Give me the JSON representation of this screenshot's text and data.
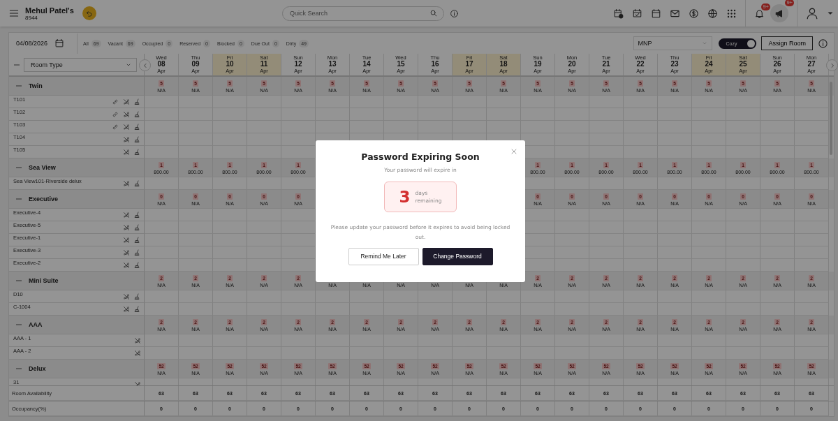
{
  "header": {
    "property": "Mehul Patel's",
    "code": "8944",
    "search": {
      "placeholder": "Quick Search"
    },
    "notifications": {
      "badge": "9+"
    },
    "announcements": {
      "badge": "9+"
    }
  },
  "filters": {
    "date": "04/08/2026",
    "statuses": [
      {
        "label": "All",
        "count": "69"
      },
      {
        "label": "Vacant",
        "count": "69"
      },
      {
        "label": "Occupied",
        "count": "0"
      },
      {
        "label": "Reserved",
        "count": "0"
      },
      {
        "label": "Blocked",
        "count": "0"
      },
      {
        "label": "Due Out",
        "count": "0"
      },
      {
        "label": "Dirty",
        "count": "49"
      }
    ],
    "rate_plan": "MNP",
    "view_toggle": {
      "label": "Cozy",
      "on": true
    },
    "assign_button": "Assign Room"
  },
  "grid": {
    "room_type_select": "Room Type",
    "days": [
      {
        "weekday": "Wed",
        "date": "08",
        "month": "Apr",
        "weekend": false
      },
      {
        "weekday": "Thu",
        "date": "09",
        "month": "Apr",
        "weekend": false
      },
      {
        "weekday": "Fri",
        "date": "10",
        "month": "Apr",
        "weekend": true
      },
      {
        "weekday": "Sat",
        "date": "11",
        "month": "Apr",
        "weekend": true
      },
      {
        "weekday": "Sun",
        "date": "12",
        "month": "Apr",
        "weekend": false
      },
      {
        "weekday": "Mon",
        "date": "13",
        "month": "Apr",
        "weekend": false
      },
      {
        "weekday": "Tue",
        "date": "14",
        "month": "Apr",
        "weekend": false
      },
      {
        "weekday": "Wed",
        "date": "15",
        "month": "Apr",
        "weekend": false
      },
      {
        "weekday": "Thu",
        "date": "16",
        "month": "Apr",
        "weekend": false
      },
      {
        "weekday": "Fri",
        "date": "17",
        "month": "Apr",
        "weekend": true
      },
      {
        "weekday": "Sat",
        "date": "18",
        "month": "Apr",
        "weekend": true
      },
      {
        "weekday": "Sun",
        "date": "19",
        "month": "Apr",
        "weekend": false
      },
      {
        "weekday": "Mon",
        "date": "20",
        "month": "Apr",
        "weekend": false
      },
      {
        "weekday": "Tue",
        "date": "21",
        "month": "Apr",
        "weekend": false
      },
      {
        "weekday": "Wed",
        "date": "22",
        "month": "Apr",
        "weekend": false
      },
      {
        "weekday": "Thu",
        "date": "23",
        "month": "Apr",
        "weekend": false
      },
      {
        "weekday": "Fri",
        "date": "24",
        "month": "Apr",
        "weekend": true
      },
      {
        "weekday": "Sat",
        "date": "25",
        "month": "Apr",
        "weekend": true
      },
      {
        "weekday": "Sun",
        "date": "26",
        "month": "Apr",
        "weekend": false
      },
      {
        "weekday": "Mon",
        "date": "27",
        "month": "Apr",
        "weekend": false
      }
    ],
    "groups": [
      {
        "name": "Twin",
        "expanded": true,
        "cells": [
          {
            "count": "5",
            "rate": "N/A"
          },
          {
            "count": "5",
            "rate": "N/A"
          },
          {
            "count": "5",
            "rate": "N/A"
          },
          {
            "count": "5",
            "rate": "N/A"
          },
          {
            "count": "5",
            "rate": "N/A"
          },
          {
            "count": "5",
            "rate": "N/A"
          },
          {
            "count": "5",
            "rate": "N/A"
          },
          {
            "count": "5",
            "rate": "N/A"
          },
          {
            "count": "5",
            "rate": "N/A"
          },
          {
            "count": "5",
            "rate": "N/A"
          },
          {
            "count": "5",
            "rate": "N/A"
          },
          {
            "count": "5",
            "rate": "N/A"
          },
          {
            "count": "5",
            "rate": "N/A"
          },
          {
            "count": "5",
            "rate": "N/A"
          },
          {
            "count": "5",
            "rate": "N/A"
          },
          {
            "count": "5",
            "rate": "N/A"
          },
          {
            "count": "5",
            "rate": "N/A"
          },
          {
            "count": "5",
            "rate": "N/A"
          },
          {
            "count": "5",
            "rate": "N/A"
          },
          {
            "count": "5",
            "rate": "N/A"
          }
        ],
        "rooms": [
          {
            "name": "T101",
            "linked": true,
            "non_smoking": true,
            "housekeeping": true
          },
          {
            "name": "T102",
            "linked": true,
            "non_smoking": true,
            "housekeeping": true
          },
          {
            "name": "T103",
            "linked": true,
            "non_smoking": true,
            "housekeeping": true
          },
          {
            "name": "T104",
            "linked": false,
            "non_smoking": true,
            "housekeeping": true
          },
          {
            "name": "T105",
            "linked": false,
            "non_smoking": true,
            "housekeeping": true
          }
        ]
      },
      {
        "name": "Sea View",
        "expanded": true,
        "cells": [
          {
            "count": "1",
            "rate": "800.00"
          },
          {
            "count": "1",
            "rate": "800.00"
          },
          {
            "count": "1",
            "rate": "800.00"
          },
          {
            "count": "1",
            "rate": "800.00"
          },
          {
            "count": "1",
            "rate": "800.00"
          },
          {},
          {},
          {},
          {},
          {},
          {},
          {
            "count": "1",
            "rate": "800.00"
          },
          {
            "count": "1",
            "rate": "800.00"
          },
          {
            "count": "1",
            "rate": "800.00"
          },
          {
            "count": "1",
            "rate": "800.00"
          },
          {
            "count": "1",
            "rate": "800.00"
          },
          {
            "count": "1",
            "rate": "800.00"
          },
          {
            "count": "1",
            "rate": "800.00"
          },
          {
            "count": "1",
            "rate": "800.00"
          },
          {
            "count": "1",
            "rate": "800.00"
          }
        ],
        "rooms": [
          {
            "name": "Sea View101-Riverside delux",
            "linked": false,
            "non_smoking": true,
            "housekeeping": true
          }
        ]
      },
      {
        "name": "Executive",
        "expanded": true,
        "cells": [
          {
            "count": "0",
            "rate": "N/A"
          },
          {
            "count": "0",
            "rate": "N/A"
          },
          {
            "count": "0",
            "rate": "N/A"
          },
          {
            "count": "0",
            "rate": "N/A"
          },
          {
            "count": "0",
            "rate": "N/A"
          },
          {},
          {},
          {},
          {},
          {},
          {},
          {
            "count": "0",
            "rate": "N/A"
          },
          {
            "count": "0",
            "rate": "N/A"
          },
          {
            "count": "0",
            "rate": "N/A"
          },
          {
            "count": "0",
            "rate": "N/A"
          },
          {
            "count": "0",
            "rate": "N/A"
          },
          {
            "count": "0",
            "rate": "N/A"
          },
          {
            "count": "0",
            "rate": "N/A"
          },
          {
            "count": "0",
            "rate": "N/A"
          },
          {
            "count": "0",
            "rate": "N/A"
          }
        ],
        "rooms": [
          {
            "name": "Executive-4",
            "linked": false,
            "non_smoking": true,
            "housekeeping": true
          },
          {
            "name": "Executive-5",
            "linked": false,
            "non_smoking": true,
            "housekeeping": true
          },
          {
            "name": "Executive-1",
            "linked": false,
            "non_smoking": true,
            "housekeeping": true
          },
          {
            "name": "Executive-3",
            "linked": false,
            "non_smoking": true,
            "housekeeping": true
          },
          {
            "name": "Executive-2",
            "linked": false,
            "non_smoking": true,
            "housekeeping": true
          }
        ]
      },
      {
        "name": "Mini Suite",
        "expanded": true,
        "cells": [
          {
            "count": "2",
            "rate": "N/A"
          },
          {
            "count": "2",
            "rate": "N/A"
          },
          {
            "count": "2",
            "rate": "N/A"
          },
          {
            "count": "2",
            "rate": "N/A"
          },
          {
            "count": "2",
            "rate": "N/A"
          },
          {
            "rate": "N/A"
          },
          {
            "rate": "N/A"
          },
          {
            "rate": "N/A"
          },
          {
            "rate": "N/A"
          },
          {
            "rate": "N/A"
          },
          {
            "rate": "N/A"
          },
          {
            "count": "2",
            "rate": "N/A"
          },
          {
            "count": "2",
            "rate": "N/A"
          },
          {
            "count": "2",
            "rate": "N/A"
          },
          {
            "count": "2",
            "rate": "N/A"
          },
          {
            "count": "2",
            "rate": "N/A"
          },
          {
            "count": "2",
            "rate": "N/A"
          },
          {
            "count": "2",
            "rate": "N/A"
          },
          {
            "count": "2",
            "rate": "N/A"
          },
          {
            "count": "2",
            "rate": "N/A"
          }
        ],
        "rooms": [
          {
            "name": "D10",
            "linked": false,
            "non_smoking": true,
            "housekeeping": true
          },
          {
            "name": "C-1004",
            "linked": false,
            "non_smoking": true,
            "housekeeping": true
          }
        ]
      },
      {
        "name": "AAA",
        "expanded": true,
        "cells": [
          {
            "count": "2",
            "rate": "N/A"
          },
          {
            "count": "2",
            "rate": "N/A"
          },
          {
            "count": "2",
            "rate": "N/A"
          },
          {
            "count": "2",
            "rate": "N/A"
          },
          {
            "count": "2",
            "rate": "N/A"
          },
          {
            "count": "2",
            "rate": "N/A"
          },
          {
            "count": "2",
            "rate": "N/A"
          },
          {
            "count": "2",
            "rate": "N/A"
          },
          {
            "count": "2",
            "rate": "N/A"
          },
          {
            "count": "2",
            "rate": "N/A"
          },
          {
            "count": "2",
            "rate": "N/A"
          },
          {
            "count": "2",
            "rate": "N/A"
          },
          {
            "count": "2",
            "rate": "N/A"
          },
          {
            "count": "2",
            "rate": "N/A"
          },
          {
            "count": "2",
            "rate": "N/A"
          },
          {
            "count": "2",
            "rate": "N/A"
          },
          {
            "count": "2",
            "rate": "N/A"
          },
          {
            "count": "2",
            "rate": "N/A"
          },
          {
            "count": "2",
            "rate": "N/A"
          },
          {
            "count": "2",
            "rate": "N/A"
          }
        ],
        "rooms": [
          {
            "name": "AAA - 1",
            "linked": false,
            "non_smoking": true,
            "housekeeping": false
          },
          {
            "name": "AAA - 2",
            "linked": false,
            "non_smoking": true,
            "housekeeping": false
          }
        ]
      },
      {
        "name": "Delux",
        "expanded": true,
        "cells": [
          {
            "count": "52",
            "rate": "N/A"
          },
          {
            "count": "52",
            "rate": "N/A"
          },
          {
            "count": "52",
            "rate": "N/A"
          },
          {
            "count": "52",
            "rate": "N/A"
          },
          {
            "count": "52",
            "rate": "N/A"
          },
          {
            "count": "52",
            "rate": "N/A"
          },
          {
            "count": "52",
            "rate": "N/A"
          },
          {
            "count": "52",
            "rate": "N/A"
          },
          {
            "count": "52",
            "rate": "N/A"
          },
          {
            "count": "52",
            "rate": "N/A"
          },
          {
            "count": "52",
            "rate": "N/A"
          },
          {
            "count": "52",
            "rate": "N/A"
          },
          {
            "count": "52",
            "rate": "N/A"
          },
          {
            "count": "52",
            "rate": "N/A"
          },
          {
            "count": "52",
            "rate": "N/A"
          },
          {
            "count": "52",
            "rate": "N/A"
          },
          {
            "count": "52",
            "rate": "N/A"
          },
          {
            "count": "52",
            "rate": "N/A"
          },
          {
            "count": "52",
            "rate": "N/A"
          },
          {
            "count": "52",
            "rate": "N/A"
          }
        ],
        "rooms": [
          {
            "name": "31",
            "linked": false,
            "non_smoking": true,
            "housekeeping": false
          }
        ]
      }
    ],
    "footer": [
      {
        "label": "Room Availability",
        "values": [
          "63",
          "63",
          "63",
          "63",
          "63",
          "63",
          "63",
          "63",
          "63",
          "63",
          "63",
          "63",
          "63",
          "63",
          "63",
          "63",
          "63",
          "63",
          "63",
          "63"
        ]
      },
      {
        "label": "Occupancy(%)",
        "values": [
          "0",
          "0",
          "0",
          "0",
          "0",
          "0",
          "0",
          "0",
          "0",
          "0",
          "0",
          "0",
          "0",
          "0",
          "0",
          "0",
          "0",
          "0",
          "0",
          "0"
        ]
      }
    ]
  },
  "modal": {
    "title": "Password Expiring Soon",
    "subtitle": "Your password will expire in",
    "days": "3",
    "days_label": "days",
    "remaining_label": "remaining",
    "message": "Please update your password before it expires to avoid being locked out.",
    "buttons": [
      {
        "label": "Remind Me Later",
        "kind": "secondary"
      },
      {
        "label": "Change Password",
        "kind": "primary"
      }
    ]
  }
}
